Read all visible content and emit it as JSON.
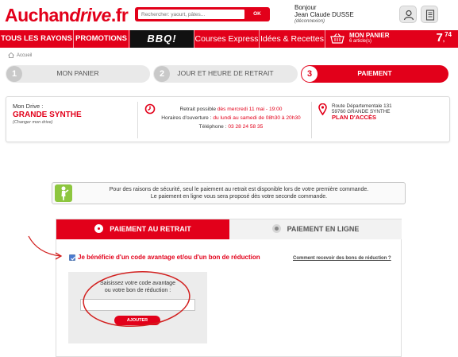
{
  "header": {
    "logo_part1": "Auchan",
    "logo_part2": "drive",
    "logo_part3": ".fr",
    "search_placeholder": "Rechercher: yaourt, pâtes...",
    "search_button": "OK",
    "greeting": "Bonjour",
    "user_name": "Jean Claude DUSSE",
    "disconnect": "(déconnexion)",
    "account_icon": "user-icon",
    "list_icon": "list-icon"
  },
  "nav": {
    "items": [
      {
        "label": "TOUS LES RAYONS"
      },
      {
        "label": "PROMOTIONS"
      },
      {
        "label": "BBQ!"
      },
      {
        "label": "Courses Express"
      },
      {
        "label": "Idées & Recettes"
      }
    ],
    "basket": {
      "title": "MON PANIER",
      "count": "6 article(s)",
      "price_int": "7",
      "price_dec": "74",
      "price_sep": ","
    }
  },
  "breadcrumb": {
    "home": "Accueil"
  },
  "steps": [
    {
      "num": "1",
      "label": "MON PANIER",
      "active": false
    },
    {
      "num": "2",
      "label": "JOUR ET HEURE DE RETRAIT",
      "active": false
    },
    {
      "num": "3",
      "label": "PAIEMENT",
      "active": true
    }
  ],
  "drive": {
    "label": "Mon Drive :",
    "name": "GRANDE SYNTHE",
    "change": "(Changer mon drive)",
    "retrait_prefix": "Retrait possible",
    "retrait_value": "dès mercredi 11 mai - 19:00",
    "horaires_prefix": "Horaires d'ouverture :",
    "horaires_value": "du lundi au samedi de 08h30 à 20h30",
    "tel_prefix": "Téléphone :",
    "tel_value": "03 28 24 58 35",
    "addr1": "Route Départementale 131",
    "addr2": "59760 GRANDE SYNTHE",
    "plan": "PLAN D'ACCÈS"
  },
  "notice": {
    "line1": "Pour des raisons de sécurité, seul le paiement au retrait est disponible lors de votre première commande.",
    "line2": "Le paiement en ligne vous sera proposé dès votre seconde commande."
  },
  "payment": {
    "tab_active": "PAIEMENT AU RETRAIT",
    "tab_inactive": "PAIEMENT EN LIGNE",
    "checkbox_label": "Je bénéficie d'un code avantage et/ou d'un bon de réduction",
    "help_link": "Comment recevoir des bons de réduction ?",
    "code_label_1": "Saisissez votre code avantage",
    "code_label_2": "ou votre bon de réduction :",
    "code_value": "",
    "add_button": "AJOUTER"
  },
  "colors": {
    "brand_red": "#e2001a",
    "annotation_red": "#d2201f"
  }
}
